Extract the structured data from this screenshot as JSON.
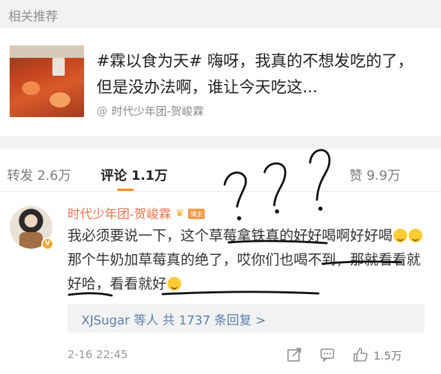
{
  "related": {
    "title": "相关推荐"
  },
  "post": {
    "text": "#霖以食为天# 嗨呀，我真的不想发吃的了，但是没办法啊，谁让今天吃这...",
    "source": "时代少年团-贺峻霖",
    "source_icon": "at-icon"
  },
  "tabs": {
    "repost": "转发 2.6万",
    "comment": "评论 1.1万",
    "like": "赞 9.9万",
    "active_color": "#ff8200"
  },
  "comment": {
    "author": "时代少年团-贺峻霖",
    "host_badge": "博主",
    "verified_badge": "V",
    "line1_a": "我必须要说一下，这个",
    "line1_b": "草莓拿铁真的",
    "line1_c": "好好喝啊好好喝",
    "line2_a": "那个牛奶加草莓真的绝了，哎",
    "line2_b": "你们也喝不到",
    "line2_c": "，那就",
    "line2_d": "看看就好哈，看看就好",
    "replies": "XJSugar 等人 共 1737 条回复 >",
    "time": "2-16 22:45",
    "likes": "1.5万",
    "name_color": "#eb7350",
    "link_color": "#5b7fae"
  }
}
